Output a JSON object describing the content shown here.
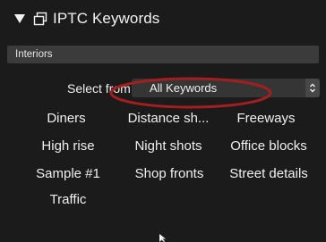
{
  "header": {
    "title": "IPTC Keywords",
    "disclosure_icon": "disclosure-triangle-down",
    "panel_icon": "window-icon"
  },
  "preset": {
    "value": "Interiors"
  },
  "select_from": {
    "label": "Select from:",
    "value": "All Keywords",
    "stepper_icon": "up-down-chevron"
  },
  "keywords": [
    [
      "Diners",
      "Distance sh...",
      "Freeways"
    ],
    [
      "High rise",
      "Night shots",
      "Office blocks"
    ],
    [
      "Sample #1",
      "Shop fronts",
      "Street details"
    ],
    [
      "Traffic"
    ]
  ],
  "colors": {
    "background": "#1b1b1b",
    "annotation": "#a31f1f",
    "field": "#3b3b3b"
  }
}
